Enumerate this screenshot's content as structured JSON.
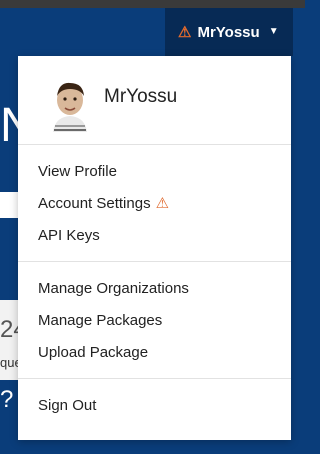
{
  "header": {
    "username": "MrYossu",
    "warning_icon": "warning-icon",
    "caret_icon": "caret-down-icon",
    "warning_color": "#e06a2e"
  },
  "background": {
    "letter": "N",
    "number": "24",
    "word": "que",
    "symbol": "?"
  },
  "dropdown": {
    "profile_name": "MrYossu",
    "avatar_icon": "avatar",
    "sections": [
      [
        "View Profile",
        "Account Settings",
        "API Keys"
      ],
      [
        "Manage Organizations",
        "Manage Packages",
        "Upload Package"
      ],
      [
        "Sign Out"
      ]
    ],
    "account_settings_warning_icon": "warning-icon"
  }
}
